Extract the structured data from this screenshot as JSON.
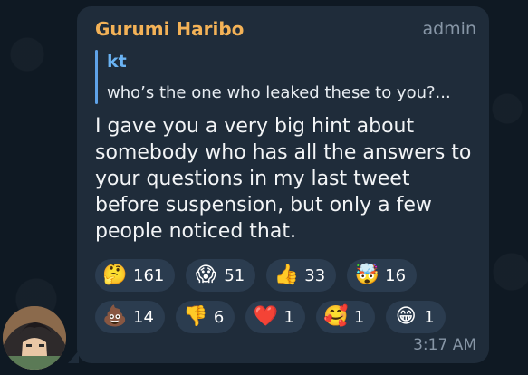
{
  "message": {
    "sender": "Gurumi Haribo",
    "role": "admin",
    "reply": {
      "author": "kt",
      "text": "who’s the one who leaked these to you?..."
    },
    "text": "I gave you a very big hint about somebody who has all the answers to your questions in my last tweet before suspension, but only a few people noticed that.",
    "time": "3:17 AM"
  },
  "reactions": [
    {
      "icon": "thinking-face",
      "glyph": "🤔",
      "count": "161"
    },
    {
      "icon": "screaming-face",
      "glyph": "😱",
      "count": "51"
    },
    {
      "icon": "thumbs-up",
      "glyph": "👍",
      "count": "33"
    },
    {
      "icon": "exploding-head",
      "glyph": "🤯",
      "count": "16"
    },
    {
      "icon": "pile-of-poo",
      "glyph": "💩",
      "count": "14"
    },
    {
      "icon": "thumbs-down",
      "glyph": "👎",
      "count": "6"
    },
    {
      "icon": "red-heart",
      "glyph": "❤️",
      "count": "1"
    },
    {
      "icon": "smiling-face-with-hearts",
      "glyph": "🥰",
      "count": "1"
    },
    {
      "icon": "grinning-face",
      "glyph": "😁",
      "count": "1"
    }
  ],
  "colors": {
    "background": "#0f1923",
    "bubble": "#1f2c3a",
    "sender": "#f3b257",
    "reply_author": "#6ab3f3",
    "reaction_pill": "#2b3c4f",
    "meta": "#8796a6"
  }
}
